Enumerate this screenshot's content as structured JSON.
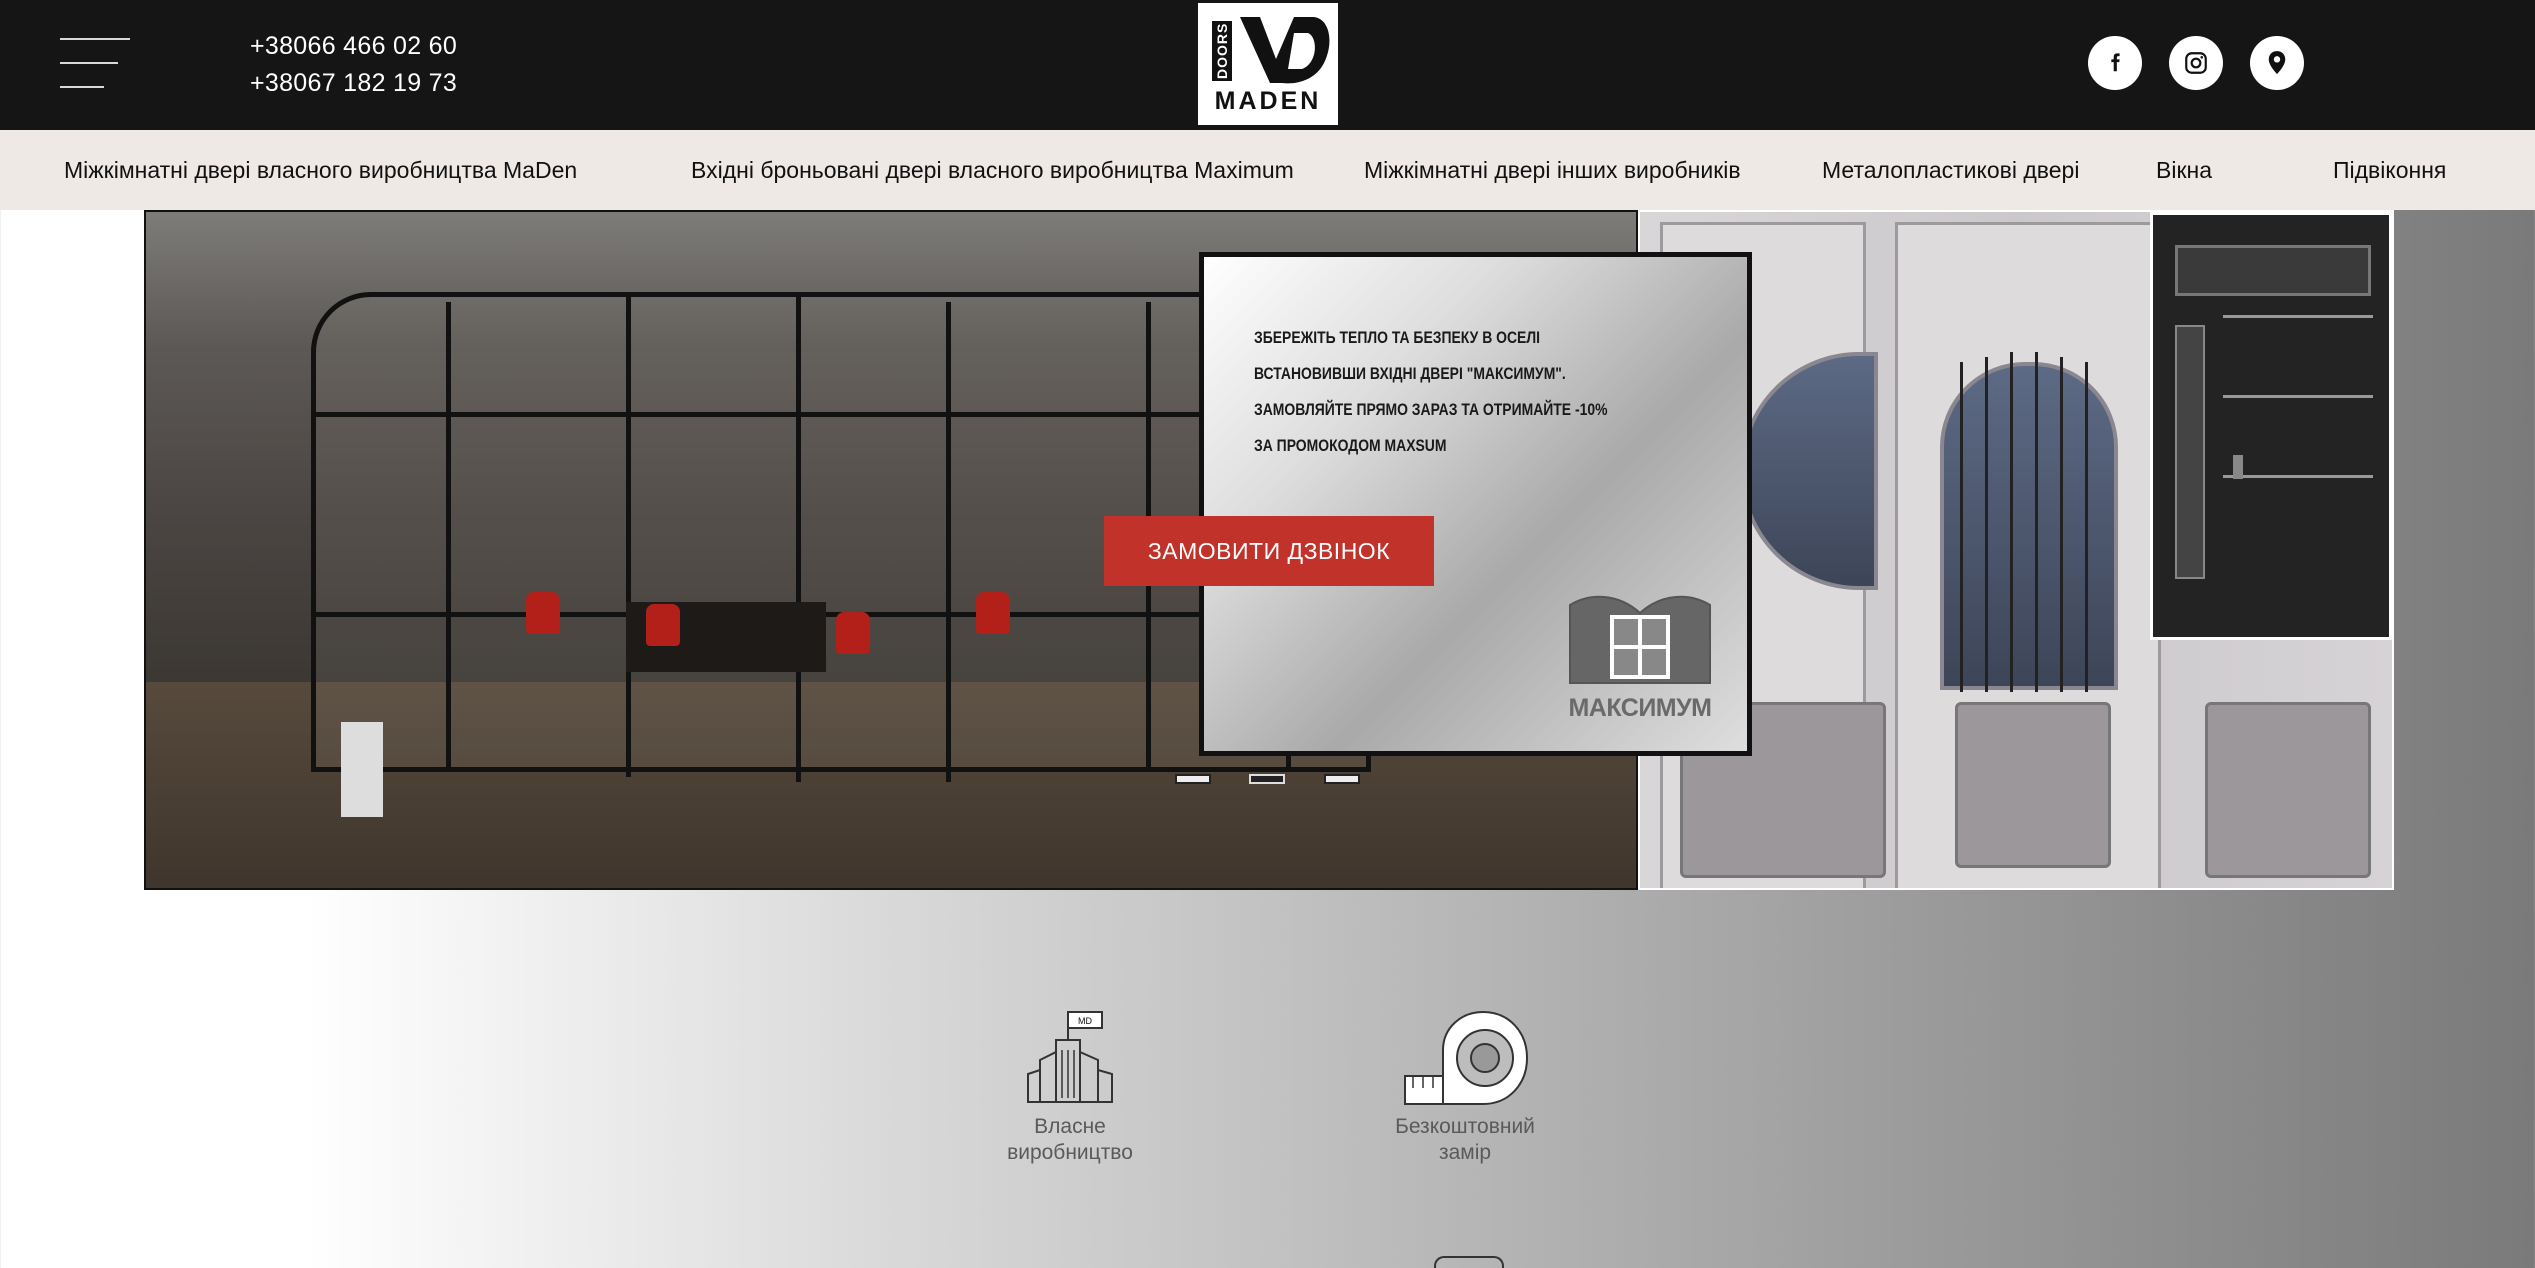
{
  "header": {
    "menu_icon": "hamburger-menu-icon",
    "phones": [
      "+38066 466 02 60",
      "+38067 182 19 73"
    ],
    "logo": {
      "side_text": "DOORS",
      "text": "MADEN"
    },
    "social": [
      {
        "name": "facebook-icon"
      },
      {
        "name": "instagram-icon"
      },
      {
        "name": "location-pin-icon"
      }
    ]
  },
  "nav": {
    "items": [
      "Міжкімнатні двері власного виробництва MaDen",
      "Вхідні броньовані двері власного виробництва Maximum",
      "Міжкімнатні двері інших виробників",
      "Металопластикові двері",
      "Вікна",
      "Підвіконня"
    ]
  },
  "slider": {
    "promo_lines": [
      "ЗБЕРЕЖІТЬ ТЕПЛО ТА БЕЗПЕКУ В ОСЕЛІ",
      "ВСТАНОВИВШИ ВХІДНІ ДВЕРІ \"МАКСИМУМ\".",
      "ЗАМОВЛЯЙТЕ ПРЯМО ЗАРАЗ ТА ОТРИМАЙТЕ -10%",
      "ЗА ПРОМОКОДОМ MAXSUM"
    ],
    "brand": "МАКСИМУМ",
    "cta_label": "ЗАМОВИТИ ДЗВІНОК",
    "dots_count": 3,
    "active_dot": 2
  },
  "features": [
    {
      "icon": "factory-icon",
      "lines": [
        "Власне",
        "виробництво"
      ]
    },
    {
      "icon": "measuring-tape-icon",
      "lines": [
        "Безкоштовний",
        "замір"
      ]
    }
  ],
  "colors": {
    "topbar": "#151515",
    "nav_bg": "#efe9e6",
    "cta": "#c0322a"
  }
}
